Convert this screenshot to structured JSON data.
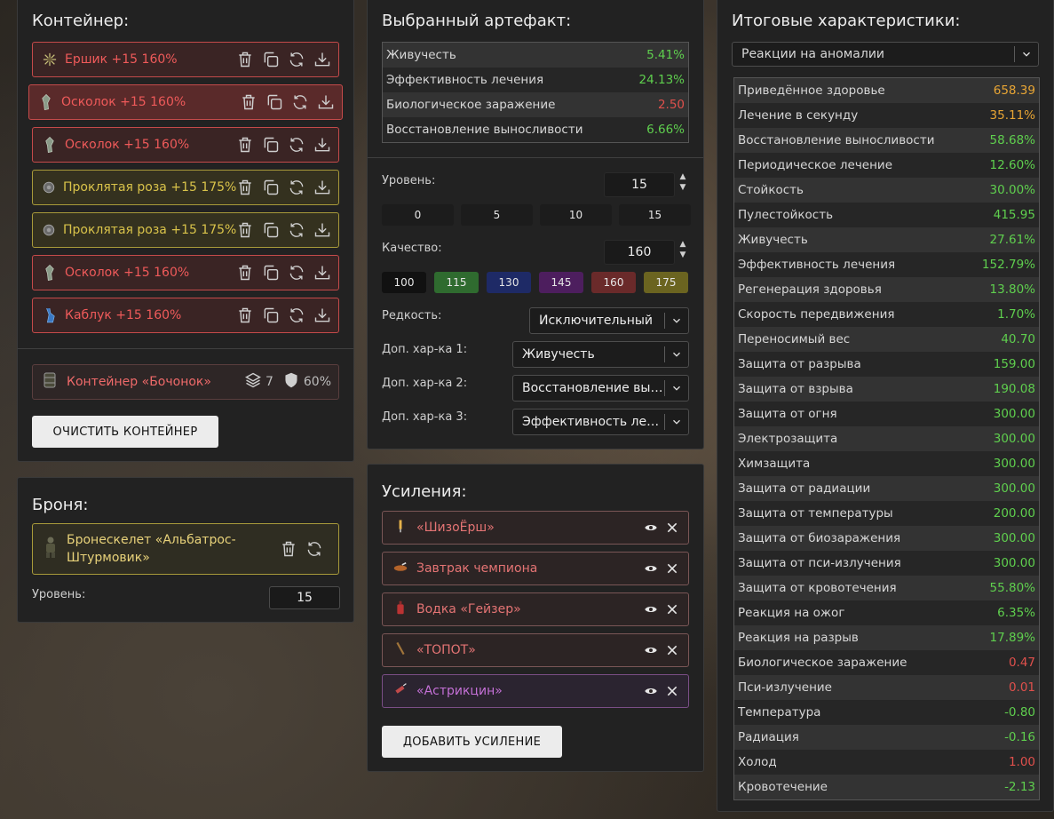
{
  "container": {
    "title": "Контейнер:",
    "items": [
      {
        "label": "Ершик +15 160%",
        "tone": "red",
        "icon": "spiky-artifact-icon"
      },
      {
        "label": "Осколок +15 160%",
        "tone": "red",
        "icon": "shard-artifact-icon"
      },
      {
        "label": "Осколок +15 160%",
        "tone": "red",
        "icon": "shard-artifact-icon"
      },
      {
        "label": "Проклятая роза +15 175%",
        "tone": "gold",
        "icon": "rose-artifact-icon"
      },
      {
        "label": "Проклятая роза +15 175%",
        "tone": "gold",
        "icon": "rose-artifact-icon"
      },
      {
        "label": "Осколок +15 160%",
        "tone": "red",
        "icon": "shard-artifact-icon"
      },
      {
        "label": "Каблук +15 160%",
        "tone": "red",
        "icon": "heel-artifact-icon"
      }
    ],
    "container_item": {
      "label": "Контейнер «Бочонок»",
      "slots": "7",
      "protection": "60%"
    },
    "clear_button": "ОЧИСТИТЬ КОНТЕЙНЕР"
  },
  "armor": {
    "title": "Броня:",
    "item_label": "Бронескелет «Альбатрос-Штурмовик»",
    "level_label": "Уровень:",
    "level_value": "15"
  },
  "artifact": {
    "title": "Выбранный артефакт:",
    "stats": [
      {
        "name": "Живучесть",
        "value": "5.41%",
        "tone": "green"
      },
      {
        "name": "Эффективность лечения",
        "value": "24.13%",
        "tone": "green"
      },
      {
        "name": "Биологическое заражение",
        "value": "2.50",
        "tone": "red"
      },
      {
        "name": "Восстановление выносливости",
        "value": "6.66%",
        "tone": "green"
      }
    ],
    "level_label": "Уровень:",
    "level_value": "15",
    "level_presets": [
      "0",
      "5",
      "10",
      "15"
    ],
    "quality_label": "Качество:",
    "quality_value": "160",
    "quality_presets": [
      {
        "label": "100",
        "color": "#111111"
      },
      {
        "label": "115",
        "color": "#2f6b2f"
      },
      {
        "label": "130",
        "color": "#1e2a66"
      },
      {
        "label": "145",
        "color": "#4d1e5e"
      },
      {
        "label": "160",
        "color": "#6a2a2a"
      },
      {
        "label": "175",
        "color": "#6b6420"
      }
    ],
    "rarity_label": "Редкость:",
    "rarity_value": "Исключительный",
    "extra1_label": "Доп. хар-ка 1:",
    "extra1_value": "Живучесть",
    "extra2_label": "Доп. хар-ка 2:",
    "extra2_value": "Восстановление выносливости",
    "extra3_label": "Доп. хар-ка 3:",
    "extra3_value": "Эффективность лечения"
  },
  "boosts": {
    "title": "Усиления:",
    "items": [
      {
        "label": "«ШизоЁрш»",
        "icon": "syringe-icon",
        "tone": "red"
      },
      {
        "label": "Завтрак чемпиона",
        "icon": "food-bowl-icon",
        "tone": "red"
      },
      {
        "label": "Водка «Гейзер»",
        "icon": "bottle-icon",
        "tone": "red"
      },
      {
        "label": "«ТОПОТ»",
        "icon": "stick-icon",
        "tone": "red"
      },
      {
        "label": "«Астрикцин»",
        "icon": "injector-icon",
        "tone": "purple"
      }
    ],
    "add_button": "ДОБАВИТЬ УСИЛЕНИЕ"
  },
  "totals": {
    "title": "Итоговые характеристики:",
    "filter_value": "Реакции на аномалии",
    "stats": [
      {
        "name": "Приведённое здоровье",
        "value": "658.39",
        "tone": "orange"
      },
      {
        "name": "Лечение в секунду",
        "value": "35.11%",
        "tone": "orange"
      },
      {
        "name": "Восстановление выносливости",
        "value": "58.68%",
        "tone": "green"
      },
      {
        "name": "Периодическое лечение",
        "value": "12.60%",
        "tone": "green"
      },
      {
        "name": "Стойкость",
        "value": "30.00%",
        "tone": "green"
      },
      {
        "name": "Пулестойкость",
        "value": "415.95",
        "tone": "green"
      },
      {
        "name": "Живучесть",
        "value": "27.61%",
        "tone": "green"
      },
      {
        "name": "Эффективность лечения",
        "value": "152.79%",
        "tone": "green"
      },
      {
        "name": "Регенерация здоровья",
        "value": "13.80%",
        "tone": "green"
      },
      {
        "name": "Скорость передвижения",
        "value": "1.70%",
        "tone": "green"
      },
      {
        "name": "Переносимый вес",
        "value": "40.70",
        "tone": "green"
      },
      {
        "name": "Защита от разрыва",
        "value": "159.00",
        "tone": "green"
      },
      {
        "name": "Защита от взрыва",
        "value": "190.08",
        "tone": "green"
      },
      {
        "name": "Защита от огня",
        "value": "300.00",
        "tone": "green"
      },
      {
        "name": "Электрозащита",
        "value": "300.00",
        "tone": "green"
      },
      {
        "name": "Химзащита",
        "value": "300.00",
        "tone": "green"
      },
      {
        "name": "Защита от радиации",
        "value": "300.00",
        "tone": "green"
      },
      {
        "name": "Защита от температуры",
        "value": "200.00",
        "tone": "green"
      },
      {
        "name": "Защита от биозаражения",
        "value": "300.00",
        "tone": "green"
      },
      {
        "name": "Защита от пси-излучения",
        "value": "300.00",
        "tone": "green"
      },
      {
        "name": "Защита от кровотечения",
        "value": "55.80%",
        "tone": "green"
      },
      {
        "name": "Реакция на ожог",
        "value": "6.35%",
        "tone": "green"
      },
      {
        "name": "Реакция на разрыв",
        "value": "17.89%",
        "tone": "green"
      },
      {
        "name": "Биологическое заражение",
        "value": "0.47",
        "tone": "red"
      },
      {
        "name": "Пси-излучение",
        "value": "0.01",
        "tone": "red"
      },
      {
        "name": "Температура",
        "value": "-0.80",
        "tone": "green"
      },
      {
        "name": "Радиация",
        "value": "-0.16",
        "tone": "green"
      },
      {
        "name": "Холод",
        "value": "1.00",
        "tone": "red"
      },
      {
        "name": "Кровотечение",
        "value": "-2.13",
        "tone": "green"
      }
    ]
  }
}
